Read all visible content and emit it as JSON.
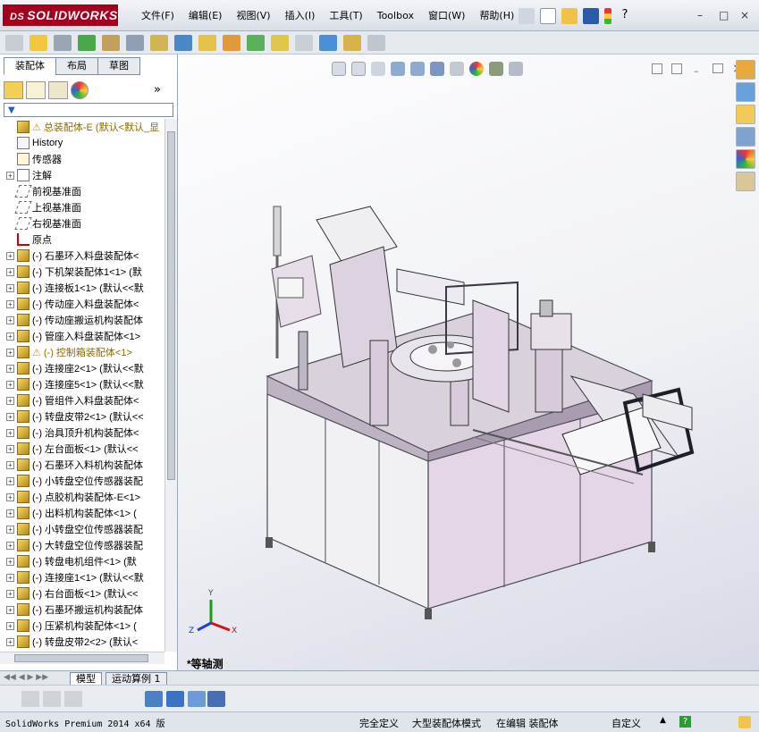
{
  "app": {
    "logo": "SOLIDWORKS",
    "logo_prefix": "DS"
  },
  "menu": [
    "文件(F)",
    "编辑(E)",
    "视图(V)",
    "插入(I)",
    "工具(T)",
    "Toolbox",
    "窗口(W)",
    "帮助(H)"
  ],
  "window_controls": {
    "minimize": "–",
    "restore": "□",
    "close": "×"
  },
  "feature_manager": {
    "tabs": [
      "装配体",
      "布局",
      "草图"
    ],
    "expand_label": "»",
    "tree": [
      {
        "label": "总装配体-E  (默认<默认_显",
        "type": "top",
        "warn": true
      },
      {
        "label": "History",
        "type": "history"
      },
      {
        "label": "传感器",
        "type": "sensor"
      },
      {
        "label": "注解",
        "type": "annotation",
        "expand": true
      },
      {
        "label": "前视基准面",
        "type": "plane"
      },
      {
        "label": "上视基准面",
        "type": "plane"
      },
      {
        "label": "右视基准面",
        "type": "plane"
      },
      {
        "label": "原点",
        "type": "origin"
      },
      {
        "label": "(-) 石墨环入料盘装配体<",
        "type": "part",
        "expand": true
      },
      {
        "label": "(-) 下机架装配体1<1> (默",
        "type": "part",
        "expand": true
      },
      {
        "label": "(-) 连接板1<1> (默认<<默",
        "type": "part",
        "expand": true
      },
      {
        "label": "(-) 传动座入料盘装配体<",
        "type": "part",
        "expand": true
      },
      {
        "label": "(-) 传动座搬运机构装配体",
        "type": "part",
        "expand": true
      },
      {
        "label": "(-) 管座入料盘装配体<1>",
        "type": "part",
        "expand": true
      },
      {
        "label": "(-) 控制箱装配体<1>",
        "type": "part",
        "expand": true,
        "warn": true
      },
      {
        "label": "(-) 连接座2<1> (默认<<默",
        "type": "part",
        "expand": true
      },
      {
        "label": "(-) 连接座5<1> (默认<<默",
        "type": "part",
        "expand": true
      },
      {
        "label": "(-) 管组件入料盘装配体<",
        "type": "part",
        "expand": true
      },
      {
        "label": "(-) 转盘皮带2<1> (默认<<",
        "type": "part",
        "expand": true
      },
      {
        "label": "(-) 治具顶升机构装配体<",
        "type": "part",
        "expand": true
      },
      {
        "label": "(-) 左台面板<1> (默认<<",
        "type": "part",
        "expand": true
      },
      {
        "label": "(-) 石墨环入料机构装配体",
        "type": "part",
        "expand": true
      },
      {
        "label": "(-) 小转盘空位传感器装配",
        "type": "part",
        "expand": true
      },
      {
        "label": "(-) 点胶机构装配体-E<1>",
        "type": "part",
        "expand": true
      },
      {
        "label": "(-) 出料机构装配体<1> (",
        "type": "part",
        "expand": true
      },
      {
        "label": "(-) 小转盘空位传感器装配",
        "type": "part",
        "expand": true
      },
      {
        "label": "(-) 大转盘空位传感器装配",
        "type": "part",
        "expand": true
      },
      {
        "label": "(-) 转盘电机组件<1> (默",
        "type": "part",
        "expand": true
      },
      {
        "label": "(-) 连接座1<1> (默认<<默",
        "type": "part",
        "expand": true
      },
      {
        "label": "(-) 右台面板<1> (默认<<",
        "type": "part",
        "expand": true
      },
      {
        "label": "(-) 石墨环搬运机构装配体",
        "type": "part",
        "expand": true
      },
      {
        "label": "(-) 压紧机构装配体<1> (",
        "type": "part",
        "expand": true
      },
      {
        "label": "(-) 转盘皮带2<2> (默认<",
        "type": "part",
        "expand": true
      }
    ]
  },
  "bottom_tabs": [
    "模型",
    "运动算例 1"
  ],
  "viewport": {
    "view_label": "*等轴测",
    "axes": {
      "x": "X",
      "y": "Y",
      "z": "Z"
    }
  },
  "status": {
    "product": "SolidWorks Premium 2014 x64 版",
    "defined": "完全定义",
    "mode": "大型装配体模式",
    "editing": "在编辑 装配体",
    "units": "自定义",
    "help": "?"
  },
  "colors": {
    "accent": "#a4001d",
    "machine_pink": "#e6d6e8",
    "frame_gray": "#4a4a52"
  }
}
